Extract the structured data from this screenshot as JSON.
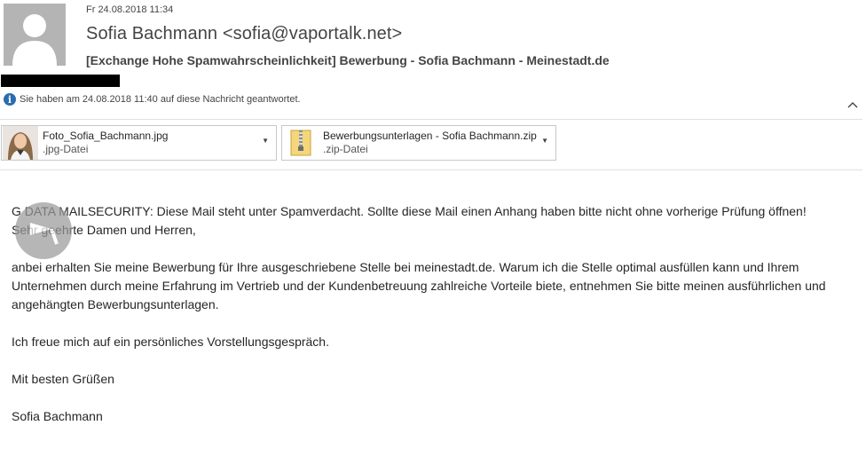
{
  "header": {
    "date": "Fr 24.08.2018 11:34",
    "sender": "Sofia Bachmann <sofia@vaportalk.net>",
    "subject": "[Exchange Hohe Spamwahrscheinlichkeit] Bewerbung - Sofia Bachmann - Meinestadt.de"
  },
  "info": {
    "text": "Sie haben am 24.08.2018 11:40 auf diese Nachricht geantwortet."
  },
  "attachments": [
    {
      "name": "Foto_Sofia_Bachmann.jpg",
      "type": ".jpg-Datei",
      "icon": "photo-thumbnail"
    },
    {
      "name": "Bewerbungsunterlagen - Sofia Bachmann.zip",
      "type": ".zip-Datei",
      "icon": "zip-folder-icon"
    }
  ],
  "body": {
    "warning": "G DATA MAILSECURITY: Diese Mail steht unter Spamverdacht. Sollte diese Mail einen Anhang haben bitte nicht ohne vorherige Prüfung öffnen!",
    "greeting": "Sehr geehrte Damen und Herren,",
    "paragraph": "anbei erhalten Sie meine Bewerbung für Ihre ausgeschriebene Stelle bei meinestadt.de. Warum ich die Stelle optimal ausfüllen kann und Ihrem Unternehmen durch meine Erfahrung im Vertrieb und der Kundenbetreuung zahlreiche Vorteile biete, entnehmen Sie bitte meinen ausführlichen und angehängten Bewerbungsunterlagen.",
    "closing_line": "Ich freue mich auf ein persönliches Vorstellungsgespräch.",
    "regards": "Mit besten Grüßen",
    "signature": "Sofia Bachmann"
  },
  "colors": {
    "info_icon": "#2b6cb0",
    "avatar_bg": "#b4b4b4"
  }
}
